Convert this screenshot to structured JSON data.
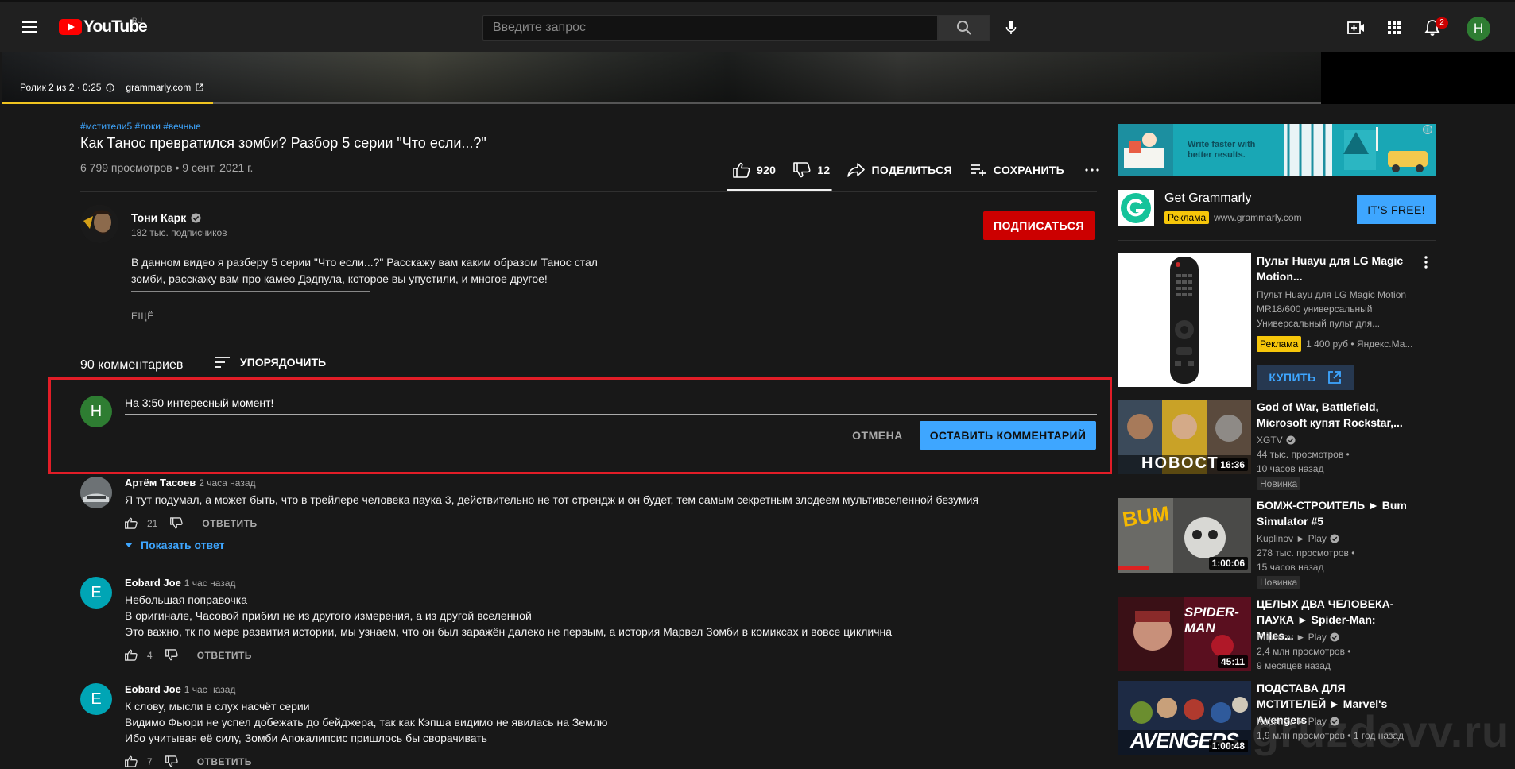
{
  "header": {
    "logo_text": "YouTube",
    "region": "RU",
    "search_placeholder": "Введите запрос",
    "notifications_count": "2",
    "avatar_letter": "H"
  },
  "player": {
    "position": "Ролик 2 из 2 · 0:25",
    "sponsor": "grammarly.com",
    "progress_fraction": 0.16
  },
  "video": {
    "tags": "#мстители5 #локи #вечные",
    "title": "Как Танос превратился зомби? Разбор 5 серии \"Что если...?\"",
    "views": "6 799 просмотров • 9 сент. 2021 г.",
    "likes": "920",
    "dislikes": "12",
    "like_fraction": 0.987,
    "share_label": "ПОДЕЛИТЬСЯ",
    "save_label": "СОХРАНИТЬ"
  },
  "channel": {
    "name": "Тони Карк",
    "subscribers": "182 тыс. подписчиков",
    "subscribe_label": "ПОДПИСАТЬСЯ"
  },
  "description": {
    "line1": "В данном видео я разберу 5 серии \"Что если...?\" Расскажу вам каким образом Танос стал",
    "line2": "зомби, расскажу вам про камео Дэдпула, которое вы упустили, и многое другое!",
    "more_label": "ЕЩЁ"
  },
  "comments_header": {
    "count_label": "90 комментариев",
    "sort_label": "УПОРЯДОЧИТЬ"
  },
  "comment_box": {
    "avatar_letter": "H",
    "text": "На 3:50 интересный момент!",
    "cancel_label": "ОТМЕНА",
    "submit_label": "ОСТАВИТЬ КОММЕНТАРИЙ"
  },
  "comments": [
    {
      "author": "Артём Тасоев",
      "time": "2 часа назад",
      "lines": [
        "Я тут подумал, а может быть, что в трейлере человека паука 3, действительно не тот стрендж и он будет, тем самым  секретным злодеем мультивселенной безумия"
      ],
      "likes": "21",
      "reply_label": "ОТВЕТИТЬ",
      "show_replies": "Показать ответ"
    },
    {
      "author": "Eobard Joe",
      "avatar_letter": "E",
      "time": "1 час назад",
      "lines": [
        "Небольшая поправочка",
        "В оригинале, Часовой прибил не из другого измерения, а из другой вселенной",
        "Это важно, тк по мере развития истории, мы узнаем, что он был заражён далеко не первым, а история Марвел Зомби в комиксах и вовсе циклична"
      ],
      "likes": "4",
      "reply_label": "ОТВЕТИТЬ"
    },
    {
      "author": "Eobard Joe",
      "avatar_letter": "E",
      "time": "1 час назад",
      "lines": [
        "К слову, мысли в слух насчёт серии",
        "Видимо Фьюри не успел добежать до бейджера, так как Кэпша видимо не явилась на Землю",
        "Ибо учитывая её силу, Зомби Апокалипсис пришлось бы сворачивать"
      ],
      "likes": "7",
      "reply_label": "ОТВЕТИТЬ"
    }
  ],
  "sidebar": {
    "banner_text": "Write faster with better results.",
    "grammarly": {
      "title": "Get Grammarly",
      "ad_label": "Реклама",
      "domain": "www.grammarly.com",
      "cta": "IT'S FREE!"
    },
    "product": {
      "title": "Пульт Huayu для LG Magic Motion...",
      "desc1": "Пульт Huayu для LG Magic Motion",
      "desc2": "MR18/600 универсальный",
      "desc3": "Универсальный пульт для...",
      "ad_label": "Реклама",
      "price": "1 400 руб • Яндекс.Ма...",
      "buy_label": "КУПИТЬ"
    },
    "videos": [
      {
        "title": "God of War, Battlefield, Microsoft купят Rockstar,...",
        "channel": "XGTV",
        "views": "44 тыс. просмотров •",
        "age": "10 часов назад",
        "badge": "Новинка",
        "duration": "16:36",
        "thumb_text": "НОВОСТ"
      },
      {
        "title": "БОМЖ-СТРОИТЕЛЬ ► Bum Simulator #5",
        "channel": "Kuplinov ► Play",
        "views": "278 тыс. просмотров •",
        "age": "15 часов назад",
        "badge": "Новинка",
        "duration": "1:00:06",
        "thumb_text": "BUM"
      },
      {
        "title": "ЦЕЛЫХ ДВА ЧЕЛОВЕКА-ПАУКА ► Spider-Man: Miles...",
        "channel": "Kuplinov ► Play",
        "views": "2,4 млн просмотров •",
        "age": "9 месяцев назад",
        "duration": "45:11",
        "thumb_text": "SPIDER-MAN"
      },
      {
        "title": "ПОДСТАВА ДЛЯ МСТИТЕЛЕЙ ► Marvel's Avengers",
        "channel": "Kuplinov ► Play",
        "views": "1,9 млн просмотров • 1 год назад",
        "duration": "1:00:48",
        "thumb_text": "AVENGERS"
      }
    ],
    "watermark": "gruzdevv.ru"
  }
}
